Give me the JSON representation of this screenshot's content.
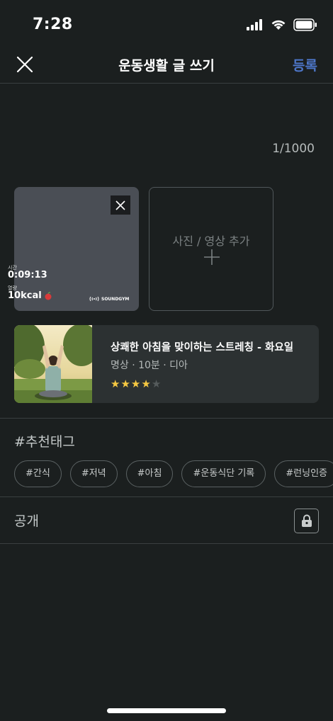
{
  "status_bar": {
    "time": "7:28"
  },
  "nav": {
    "title": "운동생활 글 쓰기",
    "submit_label": "등록"
  },
  "editor": {
    "char_count": "1/1000"
  },
  "media": {
    "time_label": "시간",
    "time_value": "0:09:13",
    "kcal_label": "열량",
    "kcal_value": "10kcal",
    "brand": "SOUNDGYM",
    "add_label": "사진 / 영상 추가"
  },
  "workout": {
    "title": "상쾌한 아침을 맞이하는 스트레칭 - 화요일",
    "meta": "명상 · 10분 · 디아",
    "rating": 4,
    "rating_max": 5
  },
  "tags": {
    "title": "#추천태그",
    "items": [
      "#간식",
      "#저녁",
      "#아침",
      "#운동식단 기록",
      "#런닝인증"
    ]
  },
  "visibility": {
    "label": "공개",
    "icon": "lock-icon"
  },
  "colors": {
    "accent": "#4d76c9",
    "star": "#f5c842",
    "background": "#1b1f1f"
  }
}
